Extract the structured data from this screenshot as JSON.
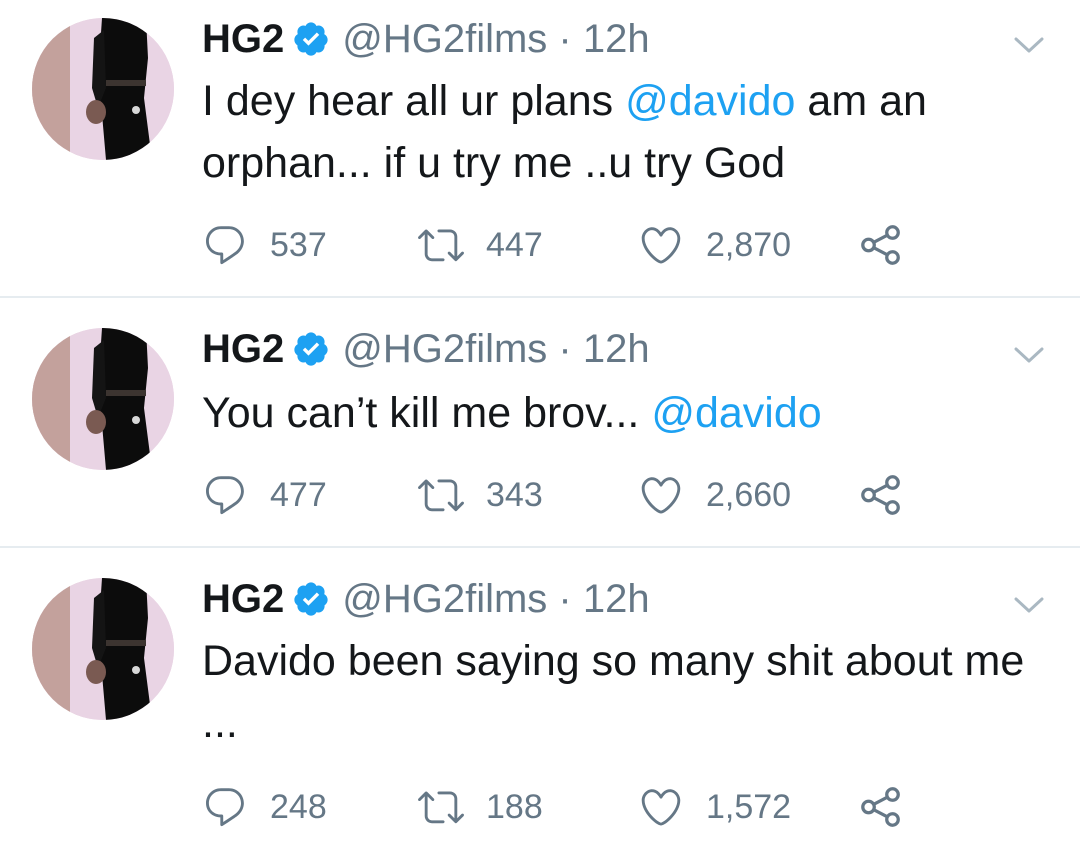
{
  "tweets": [
    {
      "name": "HG2",
      "handle": "@HG2films · 12h",
      "text_parts": [
        "I dey hear all ur plans ",
        "@davido",
        " am an orphan... if u try me ..u try God"
      ],
      "replies": "537",
      "retweets": "447",
      "likes": "2,870"
    },
    {
      "name": "HG2",
      "handle": "@HG2films · 12h",
      "text_parts": [
        "You can’t kill me brov... ",
        "@davido",
        ""
      ],
      "replies": "477",
      "retweets": "343",
      "likes": "2,660"
    },
    {
      "name": "HG2",
      "handle": "@HG2films · 12h",
      "text_parts": [
        "Davido been saying so many shit about me ...",
        "",
        ""
      ],
      "replies": "248",
      "retweets": "188",
      "likes": "1,572"
    }
  ],
  "colors": {
    "text": "#14171a",
    "secondary": "#657786",
    "accent": "#1da1f2",
    "divider": "#e6ecf0"
  },
  "icons": {
    "verified": "verified-badge-icon",
    "menu": "chevron-down-icon",
    "reply": "reply-icon",
    "retweet": "retweet-icon",
    "like": "heart-icon",
    "share": "share-icon"
  }
}
